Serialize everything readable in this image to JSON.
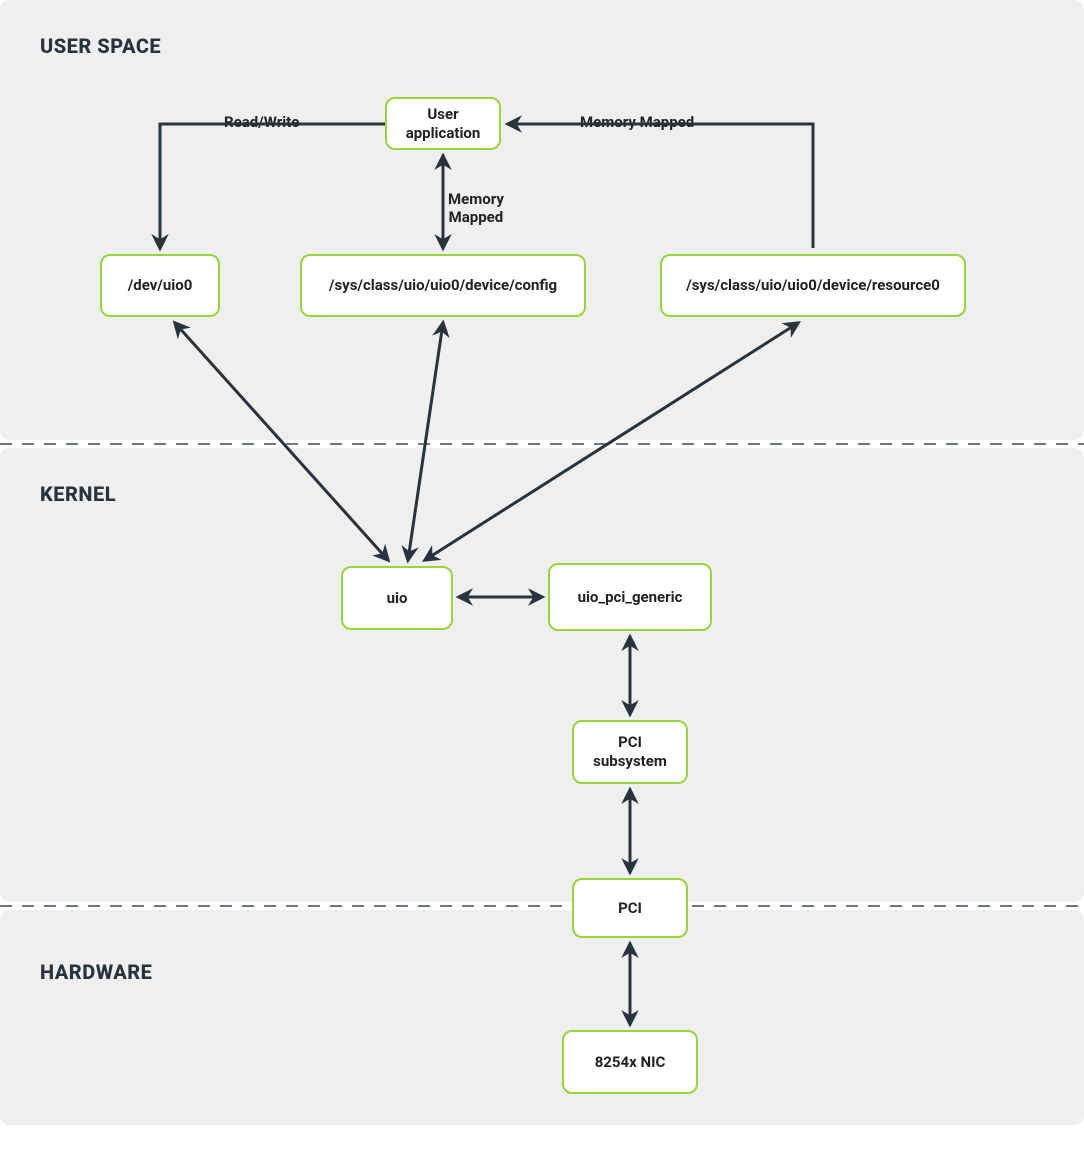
{
  "sections": {
    "user_space": "USER SPACE",
    "kernel": "KERNEL",
    "hardware": "HARDWARE"
  },
  "nodes": {
    "user_app": "User\napplication",
    "dev_uio0": "/dev/uio0",
    "sys_config": "/sys/class/uio/uio0/device/config",
    "sys_resource0": "/sys/class/uio/uio0/device/resource0",
    "uio": "uio",
    "uio_pci_generic": "uio_pci_generic",
    "pci_subsystem": "PCI\nsubsystem",
    "pci": "PCI",
    "nic": "8254x NIC"
  },
  "edge_labels": {
    "read_write": "Read/Write",
    "memory_mapped_top": "Memory Mapped",
    "memory_mapped_mid": "Memory\nMapped"
  },
  "colors": {
    "node_border": "#9ad33a",
    "arrow": "#28333d",
    "layer_bg": "#efefef"
  }
}
